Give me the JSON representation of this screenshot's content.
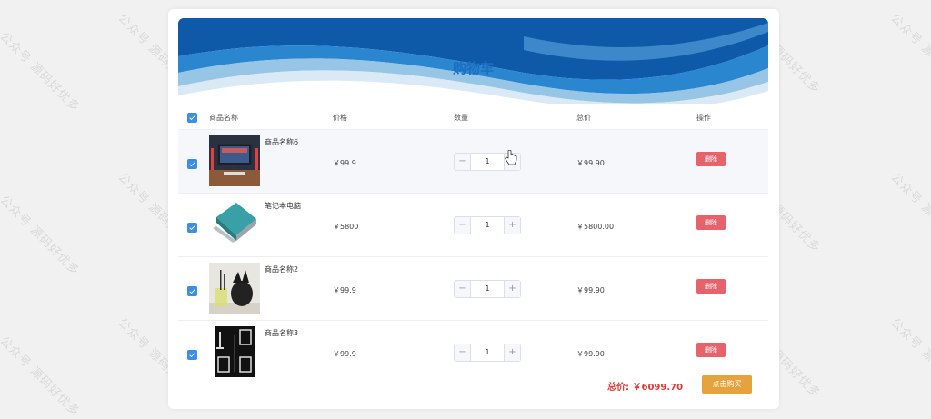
{
  "watermark": "公众号 源码好优多",
  "cart": {
    "title": "购物车",
    "headers": {
      "name": "商品名称",
      "price": "价格",
      "quantity": "数量",
      "total": "总价",
      "action": "操作"
    },
    "items": [
      {
        "name": "商品名称6",
        "price": "￥99.9",
        "quantity": "1",
        "total": "￥99.90",
        "delete_label": "删除",
        "selected": true,
        "image_icon": "monitor-desk-photo"
      },
      {
        "name": "笔记本电脑",
        "price": "￥5800",
        "quantity": "1",
        "total": "￥5800.00",
        "delete_label": "删除",
        "selected": true,
        "image_icon": "laptop-photo"
      },
      {
        "name": "商品名称2",
        "price": "￥99.9",
        "quantity": "1",
        "total": "￥99.90",
        "delete_label": "删除",
        "selected": true,
        "image_icon": "pen-holder-photo"
      },
      {
        "name": "商品名称3",
        "price": "￥99.9",
        "quantity": "1",
        "total": "￥99.90",
        "delete_label": "删除",
        "selected": true,
        "image_icon": "book-cover-photo"
      }
    ],
    "footer": {
      "total_label": "总价:",
      "total_value": "￥6099.70",
      "buy_label": "点击购买"
    }
  },
  "colors": {
    "accent": "#3a8ee6",
    "title": "#1d6fbf",
    "delete": "#e5636a",
    "buy": "#e6a23c",
    "total": "#e03a3a"
  }
}
